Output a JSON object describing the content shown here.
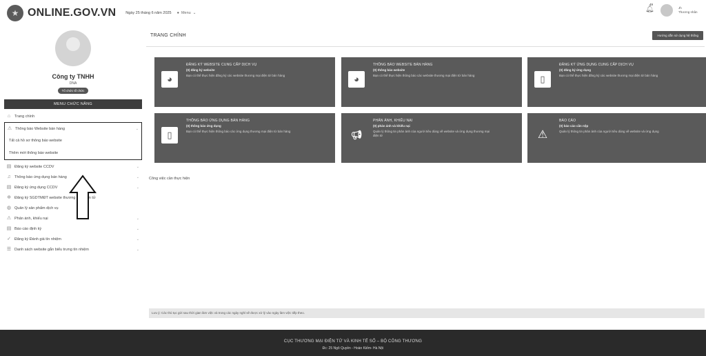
{
  "header": {
    "site_title": "ONLINE.GOV.VN",
    "date": "Ngày 25 tháng 6 năm 2025",
    "menu_label": "Menu",
    "notification_count": "49",
    "user_name": "Jh",
    "user_role": "Thương nhân"
  },
  "sidebar": {
    "company_name": "Công ty TNHH",
    "company_sub": "DNA",
    "role_badge": "Tổ chức tố chức",
    "menu_header": "MENU CHỨC NĂNG",
    "items": [
      {
        "label": "Trang chính",
        "icon": "home-icon"
      },
      {
        "label": "Thông báo Website bán hàng",
        "icon": "warning-icon"
      },
      {
        "label": "Đăng ký website CCDV",
        "icon": "document-icon"
      },
      {
        "label": "Thông báo ứng dụng bán hàng",
        "icon": "bell-icon"
      },
      {
        "label": "Đăng ký ứng dụng CCDV",
        "icon": "document-icon"
      },
      {
        "label": "Đăng ký SGDTMĐT website thương mại điện tử",
        "icon": "gear-icon"
      },
      {
        "label": "Quản lý sản phẩm dịch vụ",
        "icon": "globe-icon"
      },
      {
        "label": "Phản ánh, khiếu nại",
        "icon": "warning-icon"
      },
      {
        "label": "Báo cáo định kỳ",
        "icon": "document-icon"
      },
      {
        "label": "Đăng ký Đánh giá tín nhiệm",
        "icon": "check-icon"
      },
      {
        "label": "Danh sách website gắn biểu trưng tín nhiệm",
        "icon": "list-icon"
      }
    ],
    "submenu": [
      "Tất cả hồ sơ thông báo website",
      "Thêm mới thông báo website"
    ]
  },
  "main": {
    "title": "TRANG CHÍNH",
    "top_button": "Hướng dẫn sử dụng hệ thống",
    "cards": [
      {
        "title": "ĐĂNG KÝ WEBSITE CUNG CẤP DỊCH VỤ",
        "count": "(0) đăng ký website",
        "desc": "Bạn có thể thực hiện đăng ký các website thương mại điện tử bán hàng",
        "icon": "globe-icon"
      },
      {
        "title": "THÔNG BÁO WEBSITE BÁN HÀNG",
        "count": "(0) thông báo website",
        "desc": "Bạn có thể thực hiện thông báo các website thương mại điện tử bán hàng",
        "icon": "globe-icon"
      },
      {
        "title": "ĐĂNG KÝ ỨNG DỤNG CUNG CẤP DỊCH VỤ",
        "count": "(0) đăng ký ứng dụng",
        "desc": "Bạn có thể thực hiện đăng ký các website thương mại điện tử bán hàng",
        "icon": "phone-icon"
      },
      {
        "title": "THÔNG BÁO ỨNG DỤNG BÁN HÀNG",
        "count": "(0) thông báo ứng dụng",
        "desc": "Bạn có thể thực hiện thông báo các ứng dụng thương mại điện tử bán hàng",
        "icon": "phone-icon"
      },
      {
        "title": "PHẢN ÁNH, KHIẾU NẠI",
        "count": "(0) phản ánh và khiếu nại",
        "desc": "Quản lý thông tin phản ánh của người tiêu dùng về website và ứng dụng thương mại điện tử",
        "icon": "megaphone-icon"
      },
      {
        "title": "BÁO CÁO",
        "count": "(0) báo cáo cần nộp",
        "desc": "Quản lý thông tin phản ánh của người tiêu dùng về website và ứng dụng",
        "icon": "warning-icon"
      }
    ],
    "section_label": "Công việc cần thực hiện",
    "notice": "Lưu ý: Các thủ tục gửi sau thời gian làm việc và trong các ngày nghỉ sẽ được xử lý vào ngày làm việc tiếp theo."
  },
  "footer": {
    "line1": "CỤC THƯƠNG MẠI ĐIỆN TỬ VÀ KINH TẾ SỐ – BỘ CÔNG THƯƠNG",
    "line2": "Đc: 25 Ngô Quyền - Hoàn Kiếm- Hà Nội"
  }
}
